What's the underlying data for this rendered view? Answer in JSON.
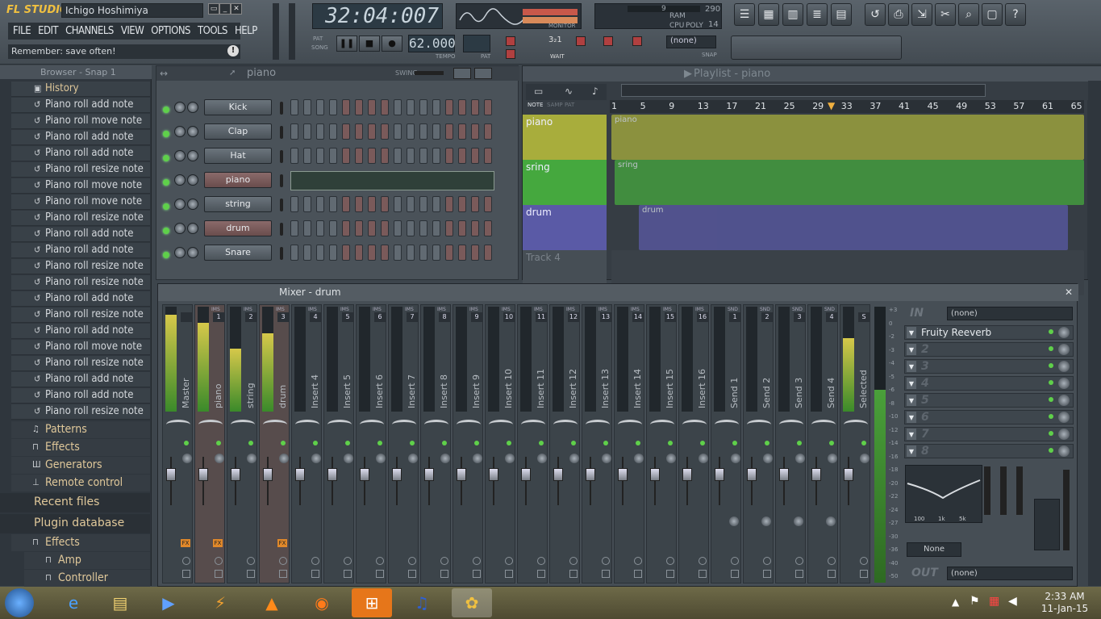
{
  "app": {
    "logo": "FL STUDIO",
    "user": "Ichigo Hoshimiya",
    "menu": [
      "FILE",
      "EDIT",
      "CHANNELS",
      "VIEW",
      "OPTIONS",
      "TOOLS",
      "HELP"
    ],
    "hint": "Remember: save often!"
  },
  "transport": {
    "song_position": "32:04:007",
    "tempo": "62.000",
    "tempo_label": "TEMPO",
    "pat_label": "PAT",
    "song_label": "SONG",
    "pattern_select": "(none)",
    "cpu_label": "CPU",
    "ram_label": "RAM",
    "poly_label": "POLY",
    "cpu_value": "9",
    "ram_value": "290",
    "poly_value": "14",
    "monitor_label": "MONITOR",
    "wait_label": "WAIT",
    "snap_label": "SNAP"
  },
  "browser": {
    "title": "Browser - Snap 1",
    "history_label": "History",
    "history_items": [
      "Piano roll add note",
      "Piano roll move note",
      "Piano roll add note",
      "Piano roll add note",
      "Piano roll resize note",
      "Piano roll move note",
      "Piano roll move note",
      "Piano roll resize note",
      "Piano roll add note",
      "Piano roll add note",
      "Piano roll resize note",
      "Piano roll resize note",
      "Piano roll add note",
      "Piano roll resize note",
      "Piano roll add note",
      "Piano roll move note",
      "Piano roll resize note",
      "Piano roll add note",
      "Piano roll add note",
      "Piano roll resize note"
    ],
    "categories": [
      "Patterns",
      "Effects",
      "Generators",
      "Remote control"
    ],
    "recent_files": "Recent files",
    "plugin_database": "Plugin database",
    "plugin_children": [
      "Effects",
      "Amp",
      "Controller"
    ]
  },
  "channel_rack": {
    "pattern_name": "piano",
    "swing_label": "SWING",
    "channels": [
      {
        "name": "Kick",
        "selected": false
      },
      {
        "name": "Clap",
        "selected": false
      },
      {
        "name": "Hat",
        "selected": false
      },
      {
        "name": "piano",
        "selected": true
      },
      {
        "name": "string",
        "selected": false
      },
      {
        "name": "drum",
        "selected": true
      },
      {
        "name": "Snare",
        "selected": false
      }
    ]
  },
  "playlist": {
    "title": "Playlist - piano",
    "tabs": [
      "NOTE",
      "SAMP",
      "PAT"
    ],
    "ruler": [
      "1",
      "5",
      "9",
      "13",
      "17",
      "21",
      "25",
      "29",
      "33",
      "37",
      "41",
      "45",
      "49",
      "53",
      "57",
      "61",
      "65"
    ],
    "tracks": [
      {
        "name": "piano",
        "clip": "piano",
        "color": "#a8ad3c"
      },
      {
        "name": "sring",
        "clip": "sring",
        "color": "#45a83e"
      },
      {
        "name": "drum",
        "clip": "drum",
        "color": "#5a5aa6"
      },
      {
        "name": "Track 4",
        "clip": "",
        "color": "#464e55"
      }
    ]
  },
  "mixer": {
    "title": "Mixer - drum",
    "strips": [
      {
        "name": "Master",
        "tag": "",
        "num": "",
        "level": 0.92
      },
      {
        "name": "piano",
        "tag": "IMS",
        "num": "1",
        "level": 0.85
      },
      {
        "name": "string",
        "tag": "IMS",
        "num": "2",
        "level": 0.6
      },
      {
        "name": "drum",
        "tag": "IMS",
        "num": "3",
        "level": 0.75
      },
      {
        "name": "Insert 4",
        "tag": "IMS",
        "num": "4",
        "level": 0
      },
      {
        "name": "Insert 5",
        "tag": "IMS",
        "num": "5",
        "level": 0
      },
      {
        "name": "Insert 6",
        "tag": "IMS",
        "num": "6",
        "level": 0
      },
      {
        "name": "Insert 7",
        "tag": "IMS",
        "num": "7",
        "level": 0
      },
      {
        "name": "Insert 8",
        "tag": "IMS",
        "num": "8",
        "level": 0
      },
      {
        "name": "Insert 9",
        "tag": "IMS",
        "num": "9",
        "level": 0
      },
      {
        "name": "Insert 10",
        "tag": "IMS",
        "num": "10",
        "level": 0
      },
      {
        "name": "Insert 11",
        "tag": "IMS",
        "num": "11",
        "level": 0
      },
      {
        "name": "Insert 12",
        "tag": "IMS",
        "num": "12",
        "level": 0
      },
      {
        "name": "Insert 13",
        "tag": "IMS",
        "num": "13",
        "level": 0
      },
      {
        "name": "Insert 14",
        "tag": "IMS",
        "num": "14",
        "level": 0
      },
      {
        "name": "Insert 15",
        "tag": "IMS",
        "num": "15",
        "level": 0
      },
      {
        "name": "Insert 16",
        "tag": "IMS",
        "num": "16",
        "level": 0
      },
      {
        "name": "Send 1",
        "tag": "SND",
        "num": "1",
        "level": 0
      },
      {
        "name": "Send 2",
        "tag": "SND",
        "num": "2",
        "level": 0
      },
      {
        "name": "Send 3",
        "tag": "SND",
        "num": "3",
        "level": 0
      },
      {
        "name": "Send 4",
        "tag": "SND",
        "num": "4",
        "level": 0
      },
      {
        "name": "Selected",
        "tag": "",
        "num": "S",
        "level": 0.7
      }
    ],
    "in_label": "IN",
    "in_value": "(none)",
    "out_label": "OUT",
    "out_value": "(none)",
    "fx_slots": [
      "Fruity Reeverb",
      "2",
      "3",
      "4",
      "5",
      "6",
      "7",
      "8"
    ],
    "eq_labels": [
      "100",
      "1k",
      "5k"
    ],
    "eq_preset": "None",
    "db_scale": [
      "+3",
      "0",
      "-2",
      "-3",
      "-4",
      "-5",
      "-6",
      "-8",
      "-10",
      "-12",
      "-14",
      "-16",
      "-18",
      "-20",
      "-22",
      "-24",
      "-27",
      "-30",
      "-36",
      "-40",
      "-50"
    ]
  },
  "taskbar": {
    "time": "2:33 AM",
    "date": "11-Jan-15"
  }
}
